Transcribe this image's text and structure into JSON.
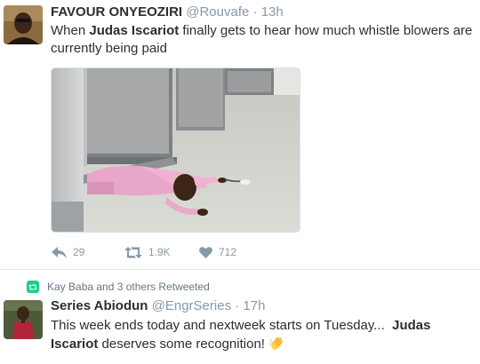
{
  "tweets": [
    {
      "name": "FAVOUR ONYEOZIRI",
      "handle": "@Rouvafe",
      "separator": "·",
      "time": "13h",
      "text_pre": "When ",
      "text_bold": "Judas Iscariot",
      "text_post": " finally gets to hear how much whistle blowers are currently being paid",
      "actions": {
        "reply_icon": "reply-icon",
        "replies": "29",
        "retweet_icon": "retweet-icon",
        "retweets": "1.9K",
        "like_icon": "heart-icon",
        "likes": "712"
      }
    },
    {
      "retweet_note": "Kay Baba and 3 others Retweeted",
      "name": "Series Abiodun",
      "handle": "@EngrSeries",
      "separator": "·",
      "time": "17h",
      "text_pre": "This week ends today and nextweek starts on Tuesday...  ",
      "text_bold": "Judas Iscariot",
      "text_post": " deserves some recognition! ",
      "emoji": "clapping-hands-emoji"
    }
  ],
  "colors": {
    "name": "#292f33",
    "muted": "#8899a6",
    "retweet_green": "#19cf86"
  }
}
